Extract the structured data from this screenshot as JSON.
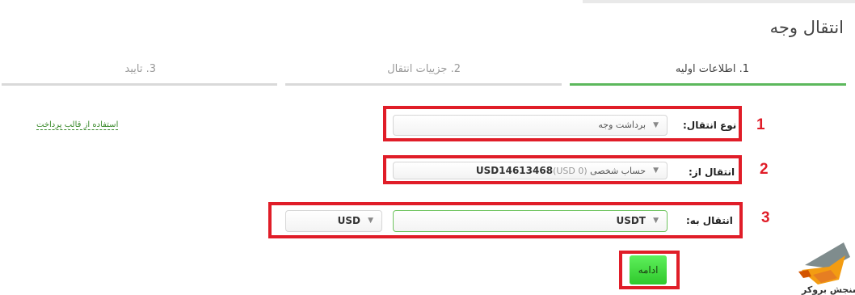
{
  "page": {
    "title": "انتقال وجه"
  },
  "steps": [
    {
      "label": "1. اطلاعات اولیه",
      "active": true
    },
    {
      "label": "2. جزییات انتقال",
      "active": false
    },
    {
      "label": "3. تایید",
      "active": false
    }
  ],
  "form": {
    "transfer_type": {
      "label": "نوع انتقال:",
      "value": "برداشت وجه"
    },
    "transfer_from": {
      "label": "انتقال از:",
      "account_name": "حساب شخصی",
      "account_id": "USD14613468",
      "balance": "(USD 0)"
    },
    "transfer_to": {
      "label": "انتقال به:",
      "value": "USDT",
      "currency": "USD"
    },
    "template_link": "استفاده از قالب پرداخت",
    "continue_label": "ادامه"
  },
  "annotations": {
    "numbers": [
      "1",
      "2",
      "3"
    ],
    "color": "#e01d28"
  },
  "watermark": {
    "text": "سنجش بروکر",
    "icon": "fox-logo-icon"
  },
  "colors": {
    "accent_green": "#5cb85c",
    "button_green": "#3cd83a"
  }
}
